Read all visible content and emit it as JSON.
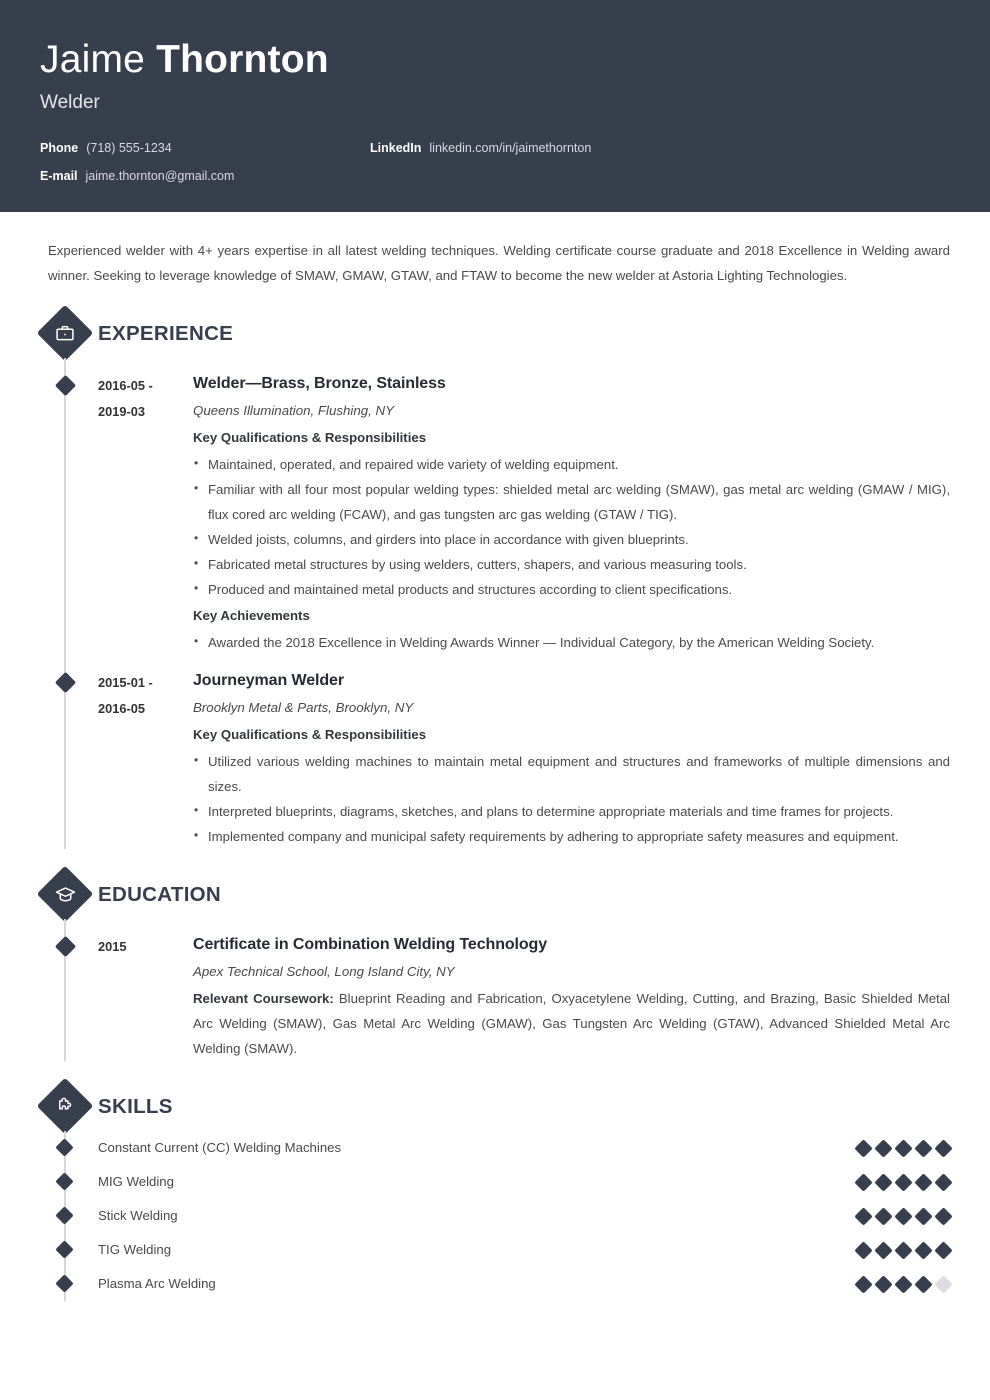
{
  "header": {
    "first_name": "Jaime",
    "last_name": "Thornton",
    "job_title": "Welder",
    "contacts": [
      {
        "label": "Phone",
        "value": "(718) 555-1234",
        "name": "phone"
      },
      {
        "label": "LinkedIn",
        "value": "linkedin.com/in/jaimethornton",
        "name": "linkedin"
      },
      {
        "label": "E-mail",
        "value": "jaime.thornton@gmail.com",
        "name": "email"
      }
    ],
    "background_color": "#373e4c"
  },
  "summary": "Experienced welder with 4+ years expertise in all latest welding techniques. Welding certificate course graduate and 2018 Excellence in Welding award winner. Seeking to leverage knowledge of SMAW, GMAW, GTAW, and FTAW to become the new welder at Astoria Lighting Technologies.",
  "sections": {
    "experience": {
      "title": "EXPERIENCE",
      "icon": "briefcase-icon",
      "entries": [
        {
          "date_from": "2016-05 -",
          "date_to": "2019-03",
          "role": "Welder—Brass, Bronze, Stainless",
          "organization": "Queens Illumination, Flushing, NY",
          "qualifications_heading": "Key Qualifications & Responsibilities",
          "qualifications": [
            "Maintained, operated, and repaired wide variety of welding equipment.",
            "Familiar with all four most popular welding types: shielded metal arc welding (SMAW), gas metal arc welding (GMAW / MIG), flux cored arc welding (FCAW), and gas tungsten arc gas welding (GTAW / TIG).",
            "Welded joists, columns, and girders into place in accordance with given blueprints.",
            "Fabricated metal structures by using welders, cutters, shapers, and various measuring tools.",
            "Produced and maintained metal products and structures according to client specifications."
          ],
          "achievements_heading": "Key Achievements",
          "achievements": [
            "Awarded the 2018 Excellence in Welding Awards Winner — Individual Category, by the American Welding Society."
          ]
        },
        {
          "date_from": "2015-01 -",
          "date_to": "2016-05",
          "role": "Journeyman Welder",
          "organization": "Brooklyn Metal & Parts, Brooklyn, NY",
          "qualifications_heading": "Key Qualifications & Responsibilities",
          "qualifications": [
            "Utilized various welding machines to maintain metal equipment and structures and frameworks of multiple dimensions and sizes.",
            "Interpreted blueprints, diagrams, sketches, and plans to determine appropriate materials and time frames for projects.",
            "Implemented company and municipal safety requirements by adhering to appropriate safety measures and equipment."
          ]
        }
      ]
    },
    "education": {
      "title": "EDUCATION",
      "icon": "graduation-cap-icon",
      "entries": [
        {
          "date": "2015",
          "degree": "Certificate in Combination Welding Technology",
          "school": "Apex Technical School, Long Island City, NY",
          "coursework_label": "Relevant Coursework:",
          "coursework": " Blueprint Reading and Fabrication, Oxyacetylene Welding, Cutting, and Brazing, Basic Shielded Metal Arc Welding (SMAW), Gas Metal Arc Welding (GMAW), Gas Tungsten Arc Welding (GTAW), Advanced Shielded Metal Arc Welding (SMAW)."
        }
      ]
    },
    "skills": {
      "title": "SKILLS",
      "icon": "puzzle-piece-icon",
      "max_rating": 5,
      "items": [
        {
          "name": "Constant Current (CC) Welding Machines",
          "rating": 5
        },
        {
          "name": "MIG Welding",
          "rating": 5
        },
        {
          "name": "Stick Welding",
          "rating": 5
        },
        {
          "name": "TIG Welding",
          "rating": 5
        },
        {
          "name": "Plasma Arc Welding",
          "rating": 4
        }
      ]
    }
  }
}
